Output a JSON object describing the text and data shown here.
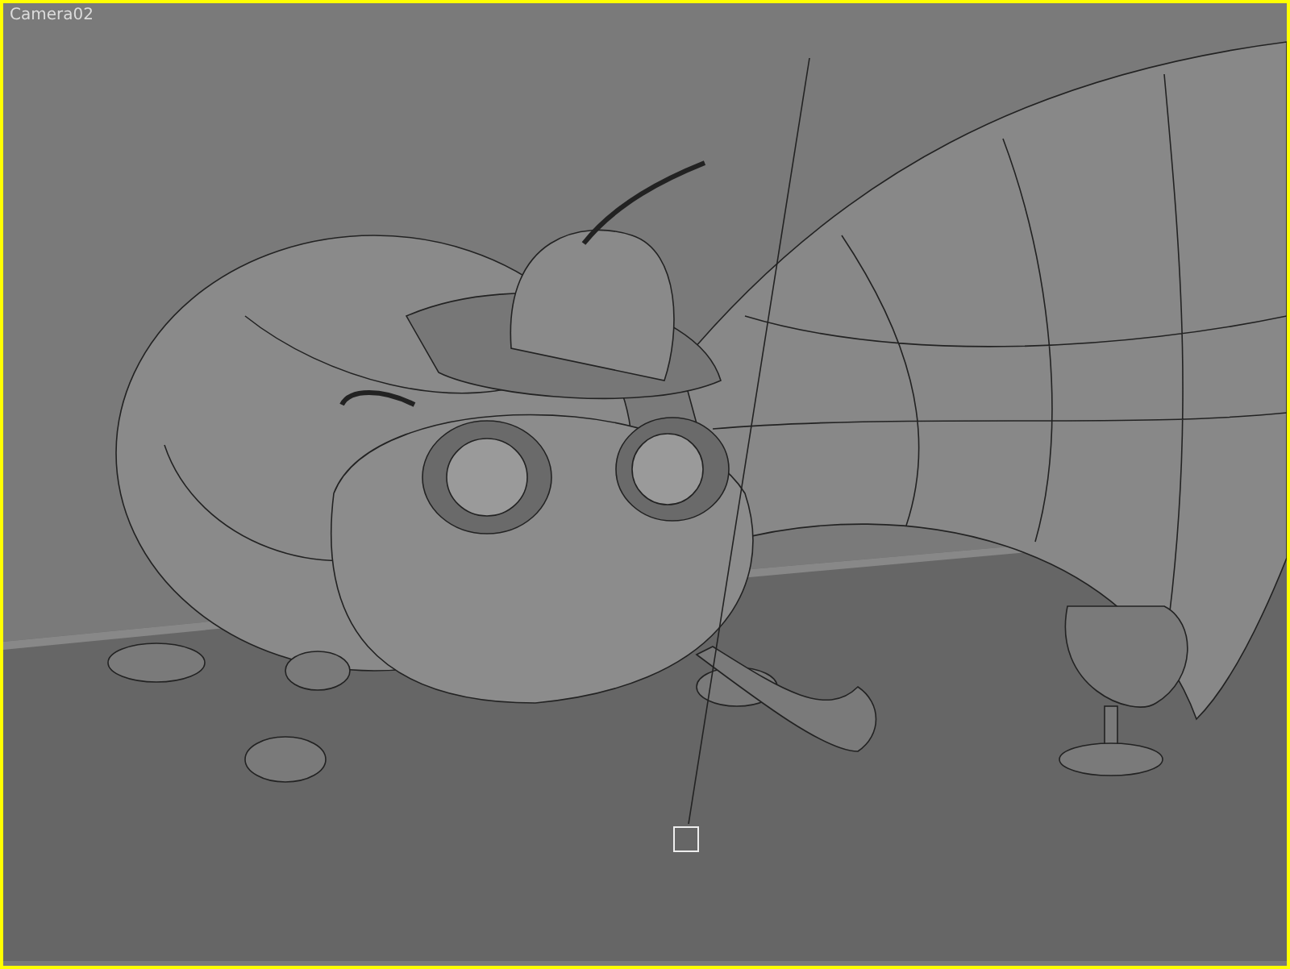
{
  "viewport": {
    "label": "Camera02",
    "active": true
  }
}
